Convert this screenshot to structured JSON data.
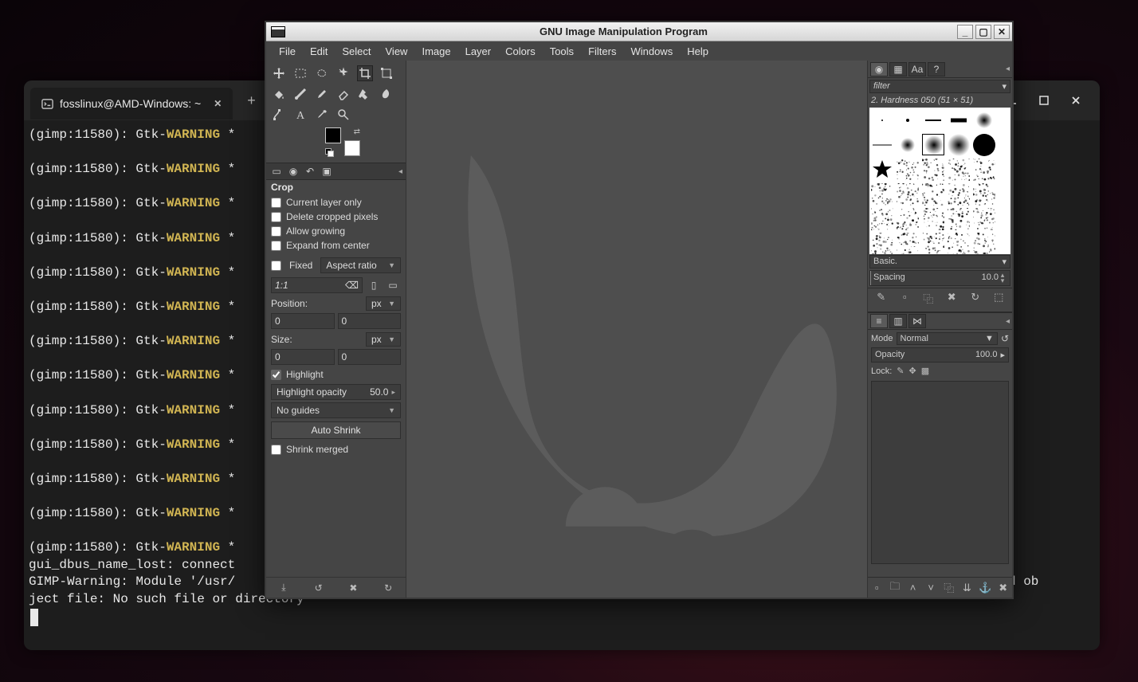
{
  "terminal": {
    "tab_title": "fosslinux@AMD-Windows: ~",
    "lines": [
      {
        "prefix": "(gimp:11580): Gtk-",
        "warn": "WARNING",
        "suffix": " *"
      },
      {
        "prefix": "(gimp:11580): Gtk-",
        "warn": "WARNING",
        "suffix": " *"
      },
      {
        "prefix": "(gimp:11580): Gtk-",
        "warn": "WARNING",
        "suffix": " *"
      },
      {
        "prefix": "(gimp:11580): Gtk-",
        "warn": "WARNING",
        "suffix": " *"
      },
      {
        "prefix": "(gimp:11580): Gtk-",
        "warn": "WARNING",
        "suffix": " *"
      },
      {
        "prefix": "(gimp:11580): Gtk-",
        "warn": "WARNING",
        "suffix": " *"
      },
      {
        "prefix": "(gimp:11580): Gtk-",
        "warn": "WARNING",
        "suffix": " *"
      },
      {
        "prefix": "(gimp:11580): Gtk-",
        "warn": "WARNING",
        "suffix": " *"
      },
      {
        "prefix": "(gimp:11580): Gtk-",
        "warn": "WARNING",
        "suffix": " *"
      },
      {
        "prefix": "(gimp:11580): Gtk-",
        "warn": "WARNING",
        "suffix": " *"
      },
      {
        "prefix": "(gimp:11580): Gtk-",
        "warn": "WARNING",
        "suffix": " *"
      },
      {
        "prefix": "(gimp:11580): Gtk-",
        "warn": "WARNING",
        "suffix": " *"
      }
    ],
    "extra1": "gui_dbus_name_lost: connect",
    "extra2": "GIMP-Warning: Module '/usr/",
    "extra2_tail": "ared ob",
    "extra3": "ject file: No such file or directory"
  },
  "gimp": {
    "title": "GNU Image Manipulation Program",
    "menus": [
      "File",
      "Edit",
      "Select",
      "View",
      "Image",
      "Layer",
      "Colors",
      "Tools",
      "Filters",
      "Windows",
      "Help"
    ],
    "crop": {
      "header": "Crop",
      "current_layer": "Current layer only",
      "delete_cropped": "Delete cropped pixels",
      "allow_growing": "Allow growing",
      "expand_center": "Expand from center",
      "fixed": "Fixed",
      "aspect_ratio": "Aspect ratio",
      "ratio_value": "1:1",
      "position": "Position:",
      "pos_unit": "px",
      "pos_x": "0",
      "pos_y": "0",
      "size": "Size:",
      "size_unit": "px",
      "size_w": "0",
      "size_h": "0",
      "highlight": "Highlight",
      "highlight_opacity_label": "Highlight opacity",
      "highlight_opacity": "50.0",
      "no_guides": "No guides",
      "auto_shrink": "Auto Shrink",
      "shrink_merged": "Shrink merged"
    },
    "brushes": {
      "filter_placeholder": "filter",
      "selected_label": "2. Hardness 050 (51 × 51)",
      "preset": "Basic.",
      "spacing_label": "Spacing",
      "spacing_value": "10.0"
    },
    "layers": {
      "mode_label": "Mode",
      "mode_value": "Normal",
      "opacity_label": "Opacity",
      "opacity_value": "100.0",
      "lock_label": "Lock:"
    }
  }
}
